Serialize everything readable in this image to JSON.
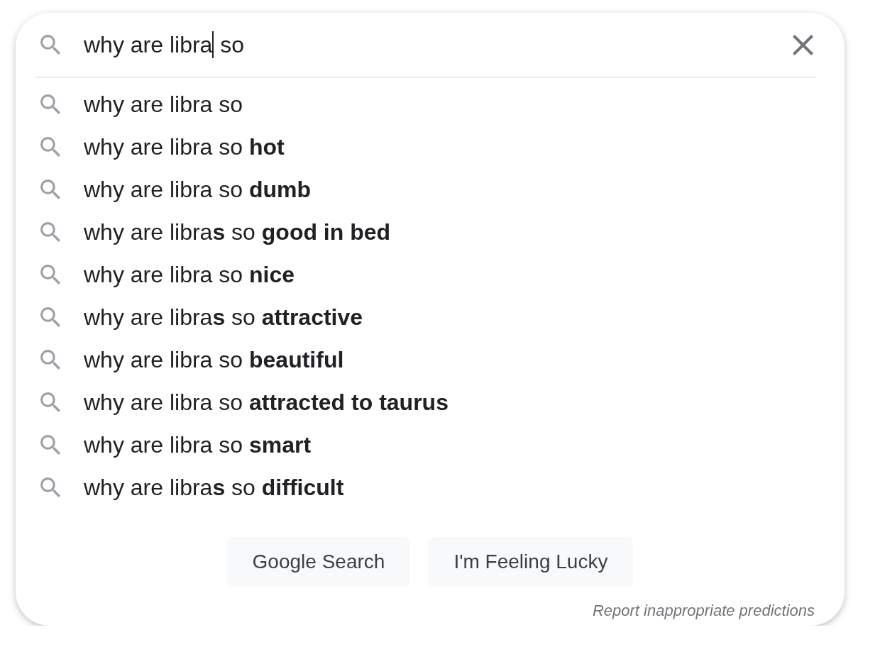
{
  "search": {
    "text_before_caret": "why are libra",
    "text_after_caret": " so",
    "focused": true
  },
  "suggestions": [
    "why are libra so",
    "why are libra so **hot**",
    "why are libra so **dumb**",
    "why are libra**s** so **good in bed**",
    "why are libra so **nice**",
    "why are libra**s** so **attractive**",
    "why are libra so **beautiful**",
    "why are libra so **attracted to taurus**",
    "why are libra so **smart**",
    "why are libra**s** so **difficult**"
  ],
  "buttons": [
    "Google Search",
    "I'm Feeling Lucky"
  ],
  "report_link": "Report inappropriate predictions"
}
